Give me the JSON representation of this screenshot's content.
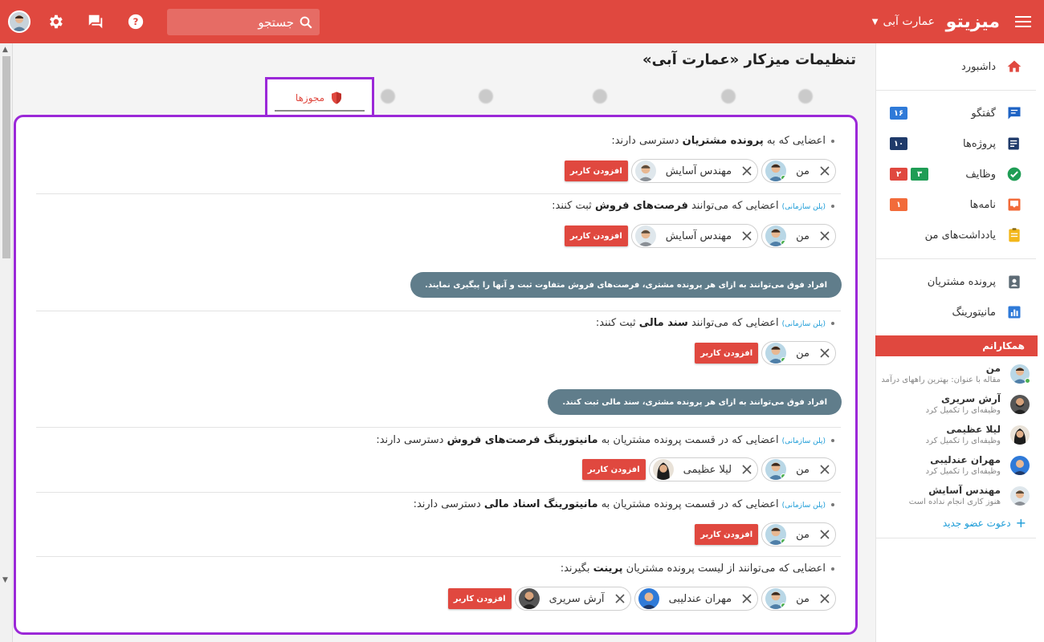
{
  "header": {
    "brand": "میزیتو",
    "workspace": "عمارت آبی",
    "search_placeholder": "جستجو"
  },
  "colors": {
    "primary": "#e0483f",
    "highlight": "#9b28d8",
    "note_bg": "#607d8b",
    "link": "#1a9bd7"
  },
  "sidebar": {
    "items": [
      {
        "label": "داشبورد",
        "icon": "home-icon"
      },
      {
        "label": "گفتگو",
        "icon": "chat-icon",
        "badges": [
          "۱۶"
        ]
      },
      {
        "label": "پروژه‌ها",
        "icon": "projects-icon",
        "badges": [
          "۱۰"
        ]
      },
      {
        "label": "وظایف",
        "icon": "task-check-icon",
        "badges": [
          "۳",
          "۲"
        ]
      },
      {
        "label": "نامه‌ها",
        "icon": "inbox-icon",
        "badges": [
          "۱"
        ]
      },
      {
        "label": "یادداشت‌های من",
        "icon": "notes-icon"
      },
      {
        "label": "پرونده مشتریان",
        "icon": "contacts-icon"
      },
      {
        "label": "مانیتورینگ",
        "icon": "chart-icon"
      }
    ],
    "colleagues_title": "همکارانم",
    "colleagues": [
      {
        "name": "من",
        "status": "مقاله با عنوان: بهترین راههای درآمد"
      },
      {
        "name": "آرش سریری",
        "status": "وظیفه‌ای را تکمیل کرد"
      },
      {
        "name": "لیلا عظیمی",
        "status": "وظیفه‌ای را تکمیل کرد"
      },
      {
        "name": "مهران عندلیبی",
        "status": "وظیفه‌ای را تکمیل کرد"
      },
      {
        "name": "مهندس آسایش",
        "status": "هنوز کاری انجام نداده است"
      }
    ],
    "invite": "دعوت عضو جدید"
  },
  "page": {
    "title": "تنظیمات میزکار «عمارت آبی»",
    "active_tab": "مجوزها"
  },
  "permissions": {
    "tag": "(پلن سازمانی)",
    "add_label": "افزودن کاربر",
    "p1": {
      "pre": "اعضایی که به",
      "bold": "پرونده مشتریان",
      "post": "دسترسی دارند:",
      "chips": [
        "من",
        "مهندس آسایش"
      ]
    },
    "p2": {
      "pre": "اعضایی که می‌توانند",
      "bold": "فرصت‌های فروش",
      "post": "ثبت کنند:",
      "chips": [
        "من",
        "مهندس آسایش"
      ],
      "note": "افراد فوق می‌توانند به ازای هر پرونده مشتری، فرصت‌های فروش متفاوت ثبت و آنها را پیگیری نمایند."
    },
    "p3": {
      "pre": "اعضایی که می‌توانند",
      "bold": "سند مالی",
      "post": "ثبت کنند:",
      "chips": [
        "من"
      ],
      "note": "افراد فوق می‌توانند به ازای هر پرونده مشتری، سند مالی ثبت کنند."
    },
    "p4": {
      "pre": "اعضایی که در قسمت پرونده مشتریان به",
      "bold": "مانیتورینگ فرصت‌های فروش",
      "post": "دسترسی دارند:",
      "chips": [
        "من",
        "لیلا عظیمی"
      ]
    },
    "p5": {
      "pre": "اعضایی که در قسمت پرونده مشتریان به",
      "bold": "مانیتورینگ اسناد مالی",
      "post": "دسترسی دارند:",
      "chips": [
        "من"
      ]
    },
    "p6": {
      "pre": "اعضایی که می‌توانند از لیست پرونده مشتریان",
      "bold": "پرینت",
      "post": "بگیرند:",
      "chips": [
        "من",
        "مهران عندلیبی",
        "آرش سریری"
      ]
    }
  }
}
